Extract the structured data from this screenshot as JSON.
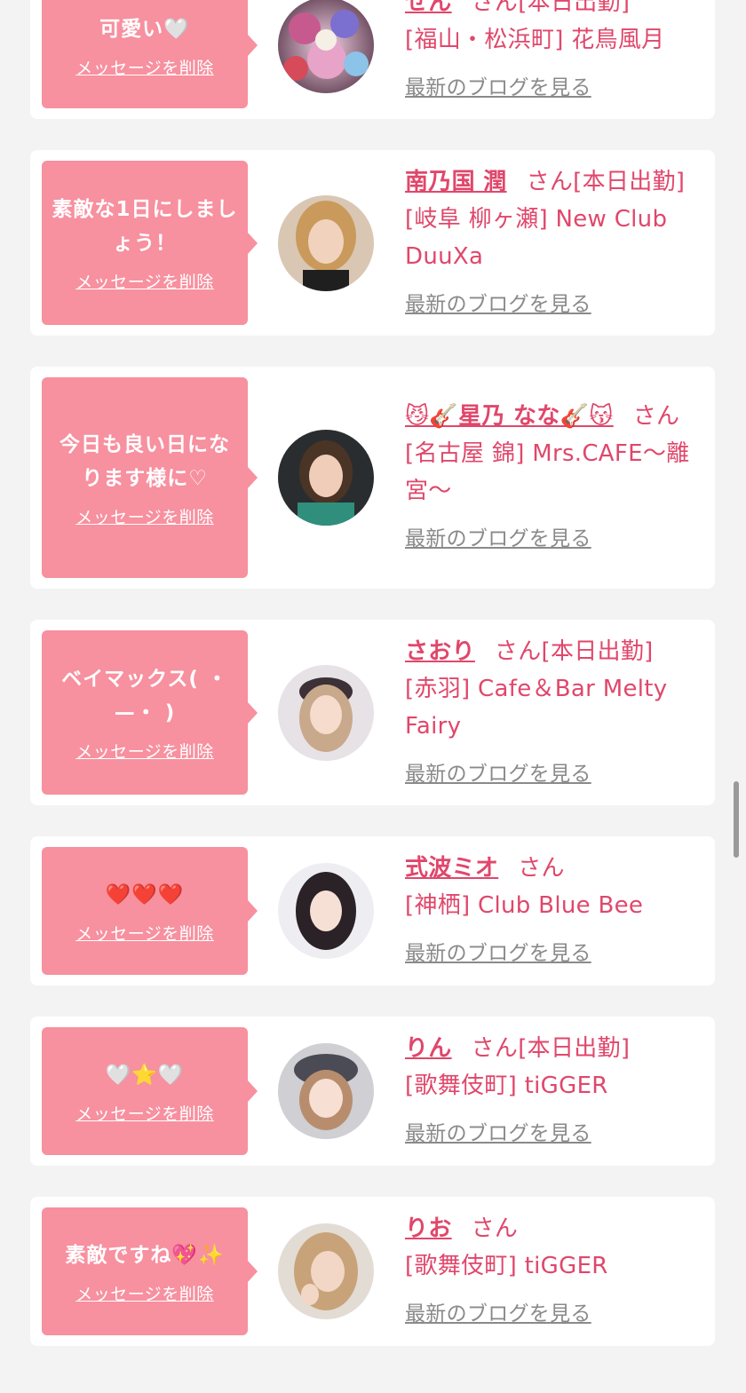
{
  "delete_label": "メッセージを削除",
  "blog_label": "最新のブログを見る",
  "colors": {
    "bubble": "#f7909f",
    "text": "#e0476b",
    "muted": "#8a8a8a",
    "background": "#f3f3f3"
  },
  "cards": [
    {
      "message": "可愛い🤍",
      "name": "せん",
      "suffix": "さん[本日出勤]",
      "location": "[福山・松浜町] 花鳥風月",
      "avatar": "avatar-colorful-kimono"
    },
    {
      "message": "素敵な1日にしましょう！",
      "name": "南乃国 潤",
      "suffix": "さん[本日出勤]",
      "location": "[岐阜 柳ヶ瀬] New Club DuuXa",
      "avatar": "avatar-blonde-woman"
    },
    {
      "message": "今日も良い日になります様に♡",
      "name": "😼🎸星乃 なな🎸😽",
      "suffix": "さん",
      "location": "[名古屋 錦] Mrs.CAFE〜離宮〜",
      "avatar": "avatar-woman-dark-bg"
    },
    {
      "message": "ベイマックス( ・—・ )",
      "name": "さおり",
      "suffix": "さん[本日出勤]",
      "location": "[赤羽] Cafe＆Bar Melty Fairy",
      "avatar": "avatar-headdress-woman"
    },
    {
      "message": "❤️❤️❤️",
      "name": "式波ミオ",
      "suffix": "さん",
      "location": "[神栖] Club Blue Bee",
      "avatar": "avatar-dark-hair-woman"
    },
    {
      "message": "🤍⭐️🤍",
      "name": "りん",
      "suffix": "さん[本日出勤]",
      "location": "[歌舞伎町] tiGGER",
      "avatar": "avatar-beret-woman"
    },
    {
      "message": "素敵ですね💖✨",
      "name": "りお",
      "suffix": "さん",
      "location": "[歌舞伎町] tiGGER",
      "avatar": "avatar-long-hair-woman"
    }
  ]
}
